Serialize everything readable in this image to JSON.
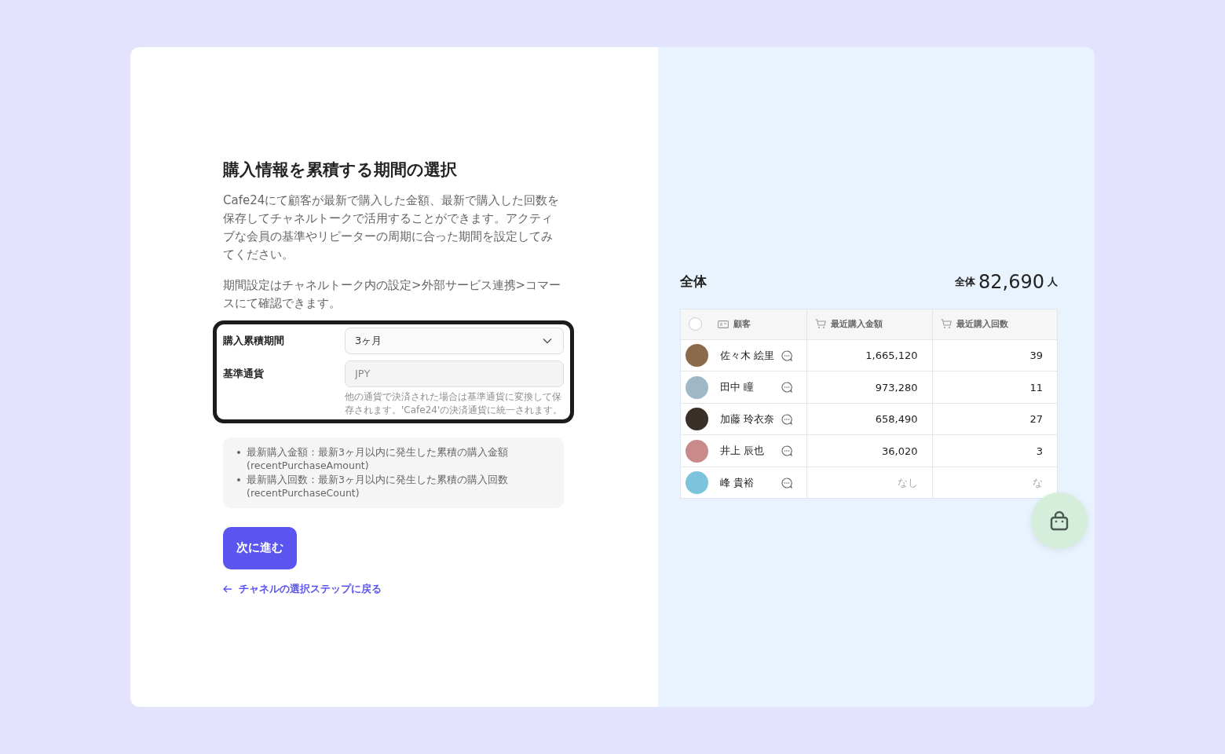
{
  "form": {
    "title": "購入情報を累積する期間の選択",
    "description": "Cafe24にて顧客が最新で購入した金額、最新で購入した回数を保存してチャネルトークで活用することができます。アクティブな会員の基準やリピーターの周期に合った期間を設定してみてください。",
    "note": "期間設定はチャネルトーク内の設定>外部サービス連携>コマースにて確認できます。",
    "period": {
      "label": "購入累積期間",
      "value": "3ヶ月"
    },
    "currency": {
      "label": "基準通貨",
      "value": "JPY",
      "disabled": true,
      "help": "他の通貨で決済された場合は基準通貨に変換して保存されます。'Cafe24'の決済通貨に統一されます。"
    },
    "info_items": [
      "最新購入金額：最新3ヶ月以内に発生した累積の購入金額(recentPurchaseAmount)",
      "最新購入回数：最新3ヶ月以内に発生した累積の購入回数(recentPurchaseCount)"
    ],
    "next_button": "次に進む",
    "back_link": "チャネルの選択ステップに戻る"
  },
  "preview": {
    "title": "全体",
    "total_label": "全体",
    "total_value": "82,690",
    "total_unit": "人",
    "table": {
      "select_all_checked": false,
      "columns": [
        "顧客",
        "最近購入金額",
        "最近購入回数"
      ],
      "rows": [
        {
          "name": "佐々木 絵里",
          "amount": "1,665,120",
          "count": "39",
          "color": "#8a6a4a"
        },
        {
          "name": "田中 瞳",
          "amount": "973,280",
          "count": "11",
          "color": "#9fb8c8"
        },
        {
          "name": "加藤 玲衣奈",
          "amount": "658,490",
          "count": "27",
          "color": "#3a3028"
        },
        {
          "name": "井上 辰也",
          "amount": "36,020",
          "count": "3",
          "color": "#c98a8a"
        },
        {
          "name": "峰 貴裕",
          "amount": "なし",
          "count": "な",
          "color": "#7cc4dc"
        }
      ]
    }
  }
}
